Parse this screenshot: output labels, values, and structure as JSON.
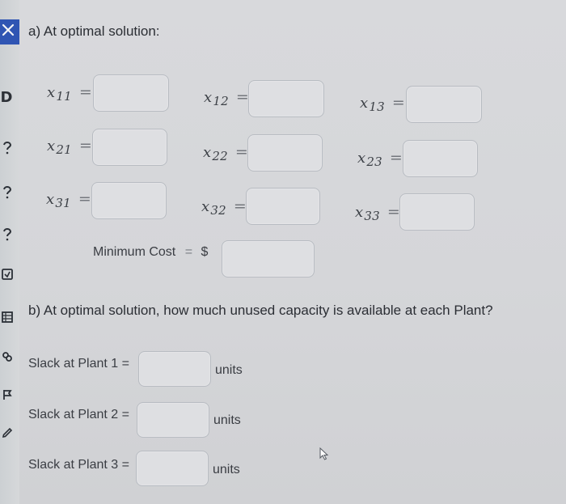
{
  "part_a": {
    "heading": "a) At optimal solution:",
    "rows": [
      [
        {
          "var": "x",
          "sub": "11",
          "eq": "="
        },
        {
          "var": "x",
          "sub": "12",
          "eq": "="
        },
        {
          "var": "x",
          "sub": "13",
          "eq": "="
        }
      ],
      [
        {
          "var": "x",
          "sub": "21",
          "eq": "="
        },
        {
          "var": "x",
          "sub": "22",
          "eq": "="
        },
        {
          "var": "x",
          "sub": "23",
          "eq": "="
        }
      ],
      [
        {
          "var": "x",
          "sub": "31",
          "eq": "="
        },
        {
          "var": "x",
          "sub": "32",
          "eq": "="
        },
        {
          "var": "x",
          "sub": "33",
          "eq": "="
        }
      ]
    ],
    "minimum_cost": {
      "label": "Minimum Cost",
      "eq": "=",
      "currency": "$"
    }
  },
  "part_b": {
    "question": "b) At optimal solution, how much unused capacity is available at each Plant?",
    "slack_rows": [
      {
        "label": "Slack at Plant 1 =",
        "units": "units"
      },
      {
        "label": "Slack at Plant 2 =",
        "units": "units"
      },
      {
        "label": "Slack at Plant 3 =",
        "units": "units"
      }
    ]
  },
  "left_rail_icons": [
    "close-icon",
    "d-letter-icon",
    "question-icon",
    "question-icon",
    "question-icon",
    "square-icon",
    "grid-icon",
    "link-icon",
    "flag-icon",
    "pen-icon"
  ],
  "left_rail_letter": "D"
}
